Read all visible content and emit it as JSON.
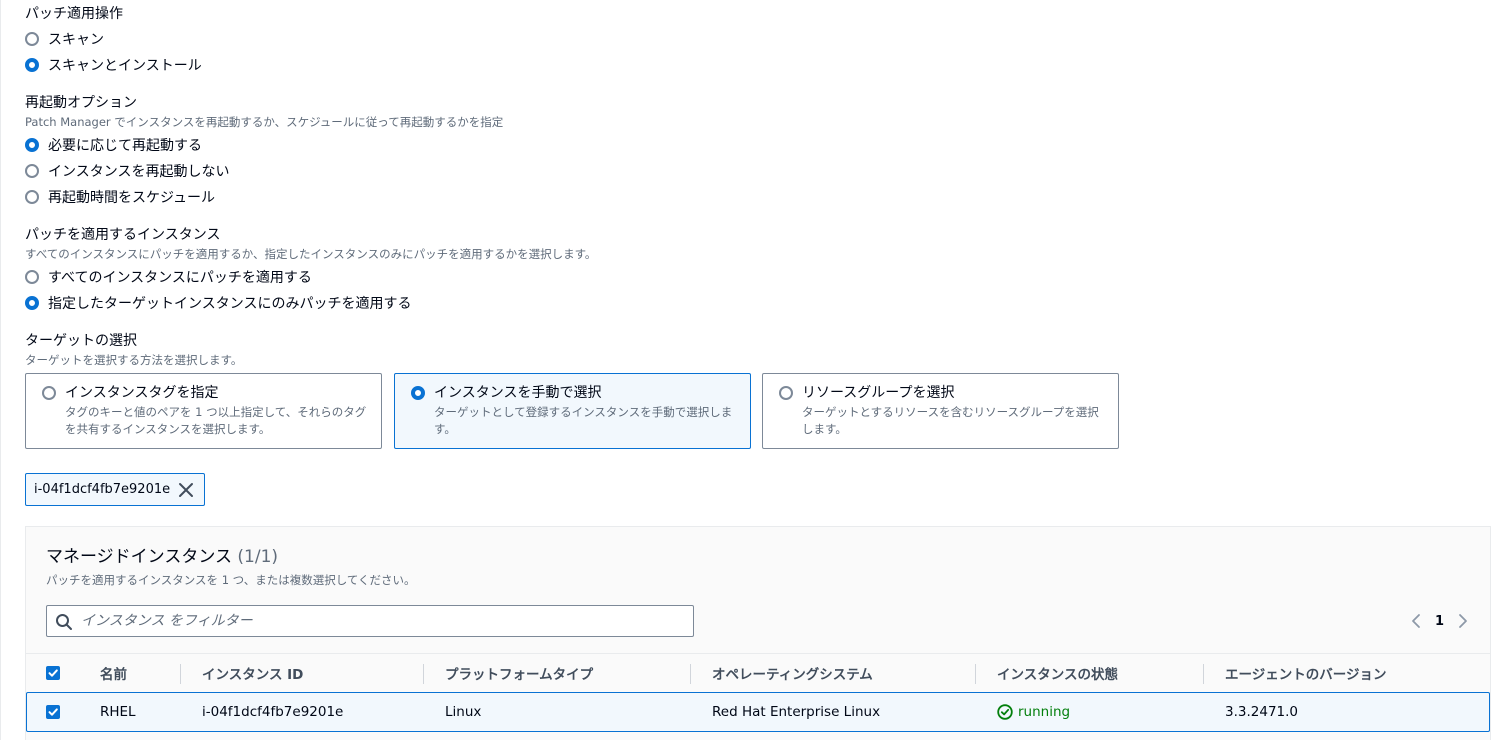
{
  "patch_operation": {
    "heading": "パッチ適用操作",
    "options": [
      {
        "label": "スキャン",
        "selected": false
      },
      {
        "label": "スキャンとインストール",
        "selected": true
      }
    ]
  },
  "reboot_option": {
    "heading": "再起動オプション",
    "description": "Patch Manager でインスタンスを再起動するか、スケジュールに従って再起動するかを指定",
    "options": [
      {
        "label": "必要に応じて再起動する",
        "selected": true
      },
      {
        "label": "インスタンスを再起動しない",
        "selected": false
      },
      {
        "label": "再起動時間をスケジュール",
        "selected": false
      }
    ]
  },
  "instances_to_patch": {
    "heading": "パッチを適用するインスタンス",
    "description": "すべてのインスタンスにパッチを適用するか、指定したインスタンスのみにパッチを適用するかを選択します。",
    "options": [
      {
        "label": "すべてのインスタンスにパッチを適用する",
        "selected": false
      },
      {
        "label": "指定したターゲットインスタンスにのみパッチを適用する",
        "selected": true
      }
    ]
  },
  "target_selection": {
    "heading": "ターゲットの選択",
    "description": "ターゲットを選択する方法を選択します。",
    "tiles": [
      {
        "title": "インスタンスタグを指定",
        "description": "タグのキーと値のペアを 1 つ以上指定して、それらのタグを共有するインスタンスを選択します。",
        "selected": false
      },
      {
        "title": "インスタンスを手動で選択",
        "description": "ターゲットとして登録するインスタンスを手動で選択します。",
        "selected": true
      },
      {
        "title": "リソースグループを選択",
        "description": "ターゲットとするリソースを含むリソースグループを選択します。",
        "selected": false
      }
    ]
  },
  "selected_token": {
    "text": "i-04f1dcf4fb7e9201e",
    "remove_icon": "close-icon"
  },
  "managed_instances": {
    "title": "マネージドインスタンス",
    "count": "(1/1)",
    "description": "パッチを適用するインスタンスを 1 つ、または複数選択してください。",
    "filter_placeholder": "インスタンス をフィルター",
    "filter_value": "",
    "page_number": "1",
    "columns": [
      "名前",
      "インスタンス ID",
      "プラットフォームタイプ",
      "オペレーティングシステム",
      "インスタンスの状態",
      "エージェントのバージョン"
    ],
    "rows": [
      {
        "selected": true,
        "name": "RHEL",
        "instance_id": "i-04f1dcf4fb7e9201e",
        "platform": "Linux",
        "os": "Red Hat Enterprise Linux",
        "state": "running",
        "agent_version": "3.3.2471.0"
      }
    ]
  },
  "colors": {
    "accent": "#0972d3",
    "success": "#037f0c",
    "text": "#000716",
    "secondary_text": "#5f6b7a"
  }
}
